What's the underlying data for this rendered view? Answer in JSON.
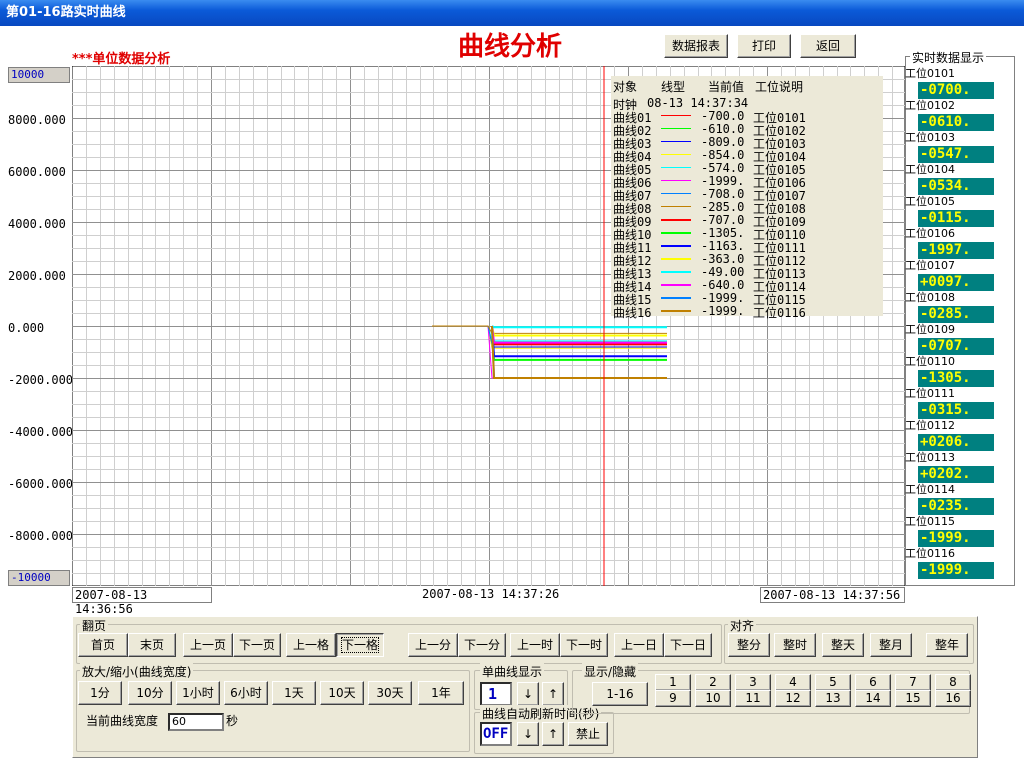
{
  "window_title": "第01-16路实时曲线",
  "main_title": "曲线分析",
  "subtitle": "***单位数据分析",
  "top_buttons": [
    "数据报表",
    "打印",
    "返回"
  ],
  "y_axis": {
    "max_box": "10000",
    "min_box": "-10000",
    "ticks": [
      "8000.000",
      "6000.000",
      "4000.000",
      "2000.000",
      "0.000",
      "-2000.000",
      "-4000.000",
      "-6000.000",
      "-8000.000"
    ]
  },
  "time_axis": {
    "start": "2007-08-13 14:36:56",
    "mid": "2007-08-13 14:37:26",
    "end": "2007-08-13 14:37:56"
  },
  "legend": {
    "header": [
      "对象",
      "线型",
      "当前值",
      "工位说明"
    ],
    "clock_label": "时钟",
    "clock_value": "08-13 14:37:34",
    "rows": [
      {
        "name": "曲线01",
        "color": "#ff0000",
        "value": "-700.0",
        "station": "工位0101"
      },
      {
        "name": "曲线02",
        "color": "#00ff00",
        "value": "-610.0",
        "station": "工位0102"
      },
      {
        "name": "曲线03",
        "color": "#0000ff",
        "value": "-809.0",
        "station": "工位0103"
      },
      {
        "name": "曲线04",
        "color": "#ffff00",
        "value": "-854.0",
        "station": "工位0104"
      },
      {
        "name": "曲线05",
        "color": "#00ffff",
        "value": "-574.0",
        "station": "工位0105"
      },
      {
        "name": "曲线06",
        "color": "#ff00ff",
        "value": "-1999.",
        "station": "工位0106"
      },
      {
        "name": "曲线07",
        "color": "#0080ff",
        "value": "-708.0",
        "station": "工位0107"
      },
      {
        "name": "曲线08",
        "color": "#c08000",
        "value": "-285.0",
        "station": "工位0108"
      },
      {
        "name": "曲线09",
        "color": "#ff0000",
        "value": "-707.0",
        "station": "工位0109"
      },
      {
        "name": "曲线10",
        "color": "#00ff00",
        "value": "-1305.",
        "station": "工位0110"
      },
      {
        "name": "曲线11",
        "color": "#0000ff",
        "value": "-1163.",
        "station": "工位0111"
      },
      {
        "name": "曲线12",
        "color": "#ffff00",
        "value": "-363.0",
        "station": "工位0112"
      },
      {
        "name": "曲线13",
        "color": "#00ffff",
        "value": "-49.00",
        "station": "工位0113"
      },
      {
        "name": "曲线14",
        "color": "#ff00ff",
        "value": "-640.0",
        "station": "工位0114"
      },
      {
        "name": "曲线15",
        "color": "#0080ff",
        "value": "-1999.",
        "station": "工位0115"
      },
      {
        "name": "曲线16",
        "color": "#c08000",
        "value": "-1999.",
        "station": "工位0116"
      }
    ]
  },
  "realtime": {
    "title": "实时数据显示",
    "items": [
      {
        "label": "工位0101",
        "value": "-0700."
      },
      {
        "label": "工位0102",
        "value": "-0610."
      },
      {
        "label": "工位0103",
        "value": "-0547."
      },
      {
        "label": "工位0104",
        "value": "-0534."
      },
      {
        "label": "工位0105",
        "value": "-0115."
      },
      {
        "label": "工位0106",
        "value": "-1997."
      },
      {
        "label": "工位0107",
        "value": "+0097."
      },
      {
        "label": "工位0108",
        "value": "-0285."
      },
      {
        "label": "工位0109",
        "value": "-0707."
      },
      {
        "label": "工位0110",
        "value": "-1305."
      },
      {
        "label": "工位0111",
        "value": "-0315."
      },
      {
        "label": "工位0112",
        "value": "+0206."
      },
      {
        "label": "工位0113",
        "value": "+0202."
      },
      {
        "label": "工位0114",
        "value": "-0235."
      },
      {
        "label": "工位0115",
        "value": "-1999."
      },
      {
        "label": "工位0116",
        "value": "-1999."
      }
    ]
  },
  "paging": {
    "label": "翻页",
    "buttons": [
      "首页",
      "末页",
      "上一页",
      "下一页",
      "上一格",
      "下一格",
      "上一分",
      "下一分",
      "上一时",
      "下一时",
      "上一日",
      "下一日"
    ]
  },
  "align": {
    "label": "对齐",
    "buttons": [
      "整分",
      "整时",
      "整天",
      "整月",
      "整年"
    ]
  },
  "zoom": {
    "label": "放大/缩小(曲线宽度)",
    "buttons": [
      "1分",
      "10分",
      "1小时",
      "6小时",
      "1天",
      "10天",
      "30天",
      "1年"
    ],
    "width_label": "当前曲线宽度",
    "width_value": "60",
    "unit": "秒"
  },
  "single": {
    "label": "单曲线显示",
    "value": "1",
    "down": "↓",
    "up": "↑"
  },
  "refresh": {
    "label": "曲线自动刷新时间(秒)",
    "value": "OFF",
    "down": "↓",
    "up": "↑",
    "stop": "禁止"
  },
  "showhide": {
    "label": "显示/隐藏",
    "all": "1-16",
    "top": [
      "1",
      "2",
      "3",
      "4",
      "5",
      "6",
      "7",
      "8"
    ],
    "bottom": [
      "9",
      "10",
      "11",
      "12",
      "13",
      "14",
      "15",
      "16"
    ]
  }
}
